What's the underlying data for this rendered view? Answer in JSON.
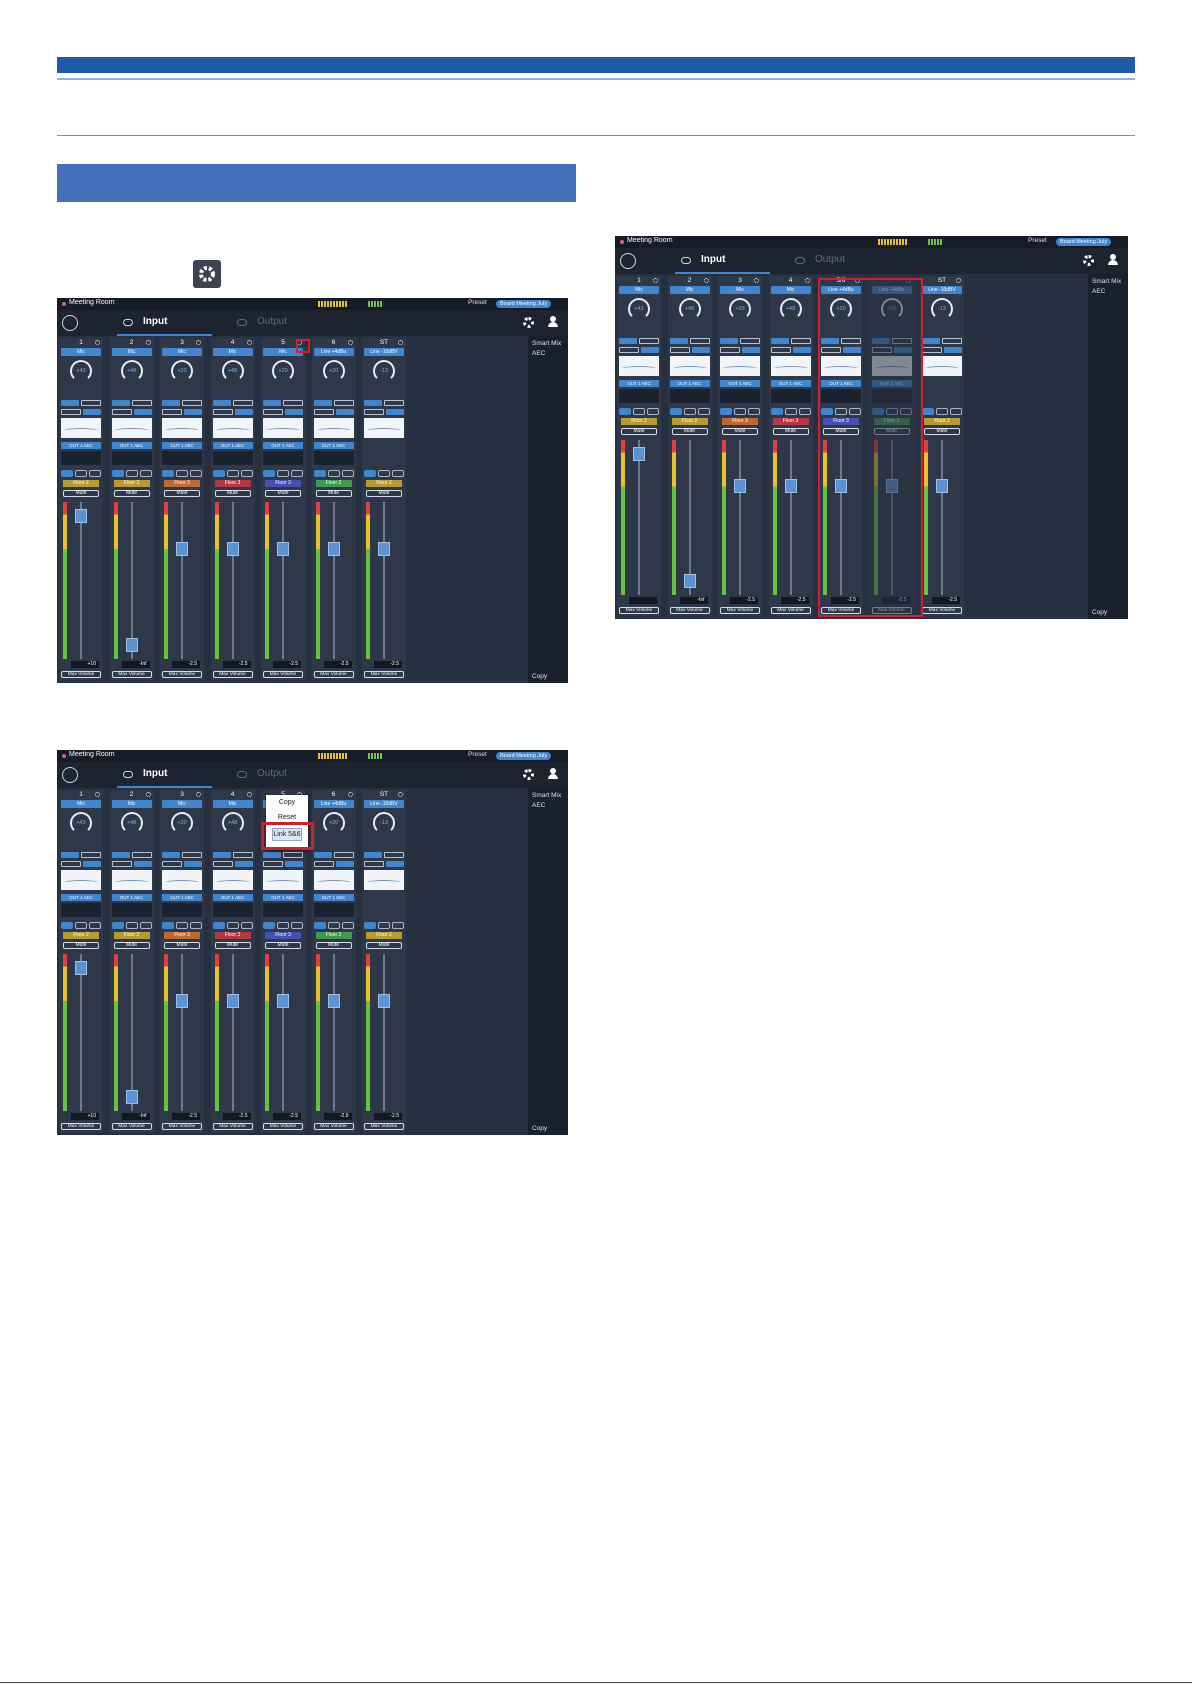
{
  "mixers": [
    {
      "room_name": "Meeting Room",
      "preset_label": "Preset",
      "preset_value": "Board Meeting July",
      "tab_input": "Input",
      "tab_output": "Output",
      "side_items": [
        "Smart Mix",
        "AEC"
      ],
      "side_copy": "Copy",
      "strips": [
        {
          "num": "1",
          "type": "Mic",
          "gain": "+43",
          "aec": "OUT 1 AEC",
          "floor": "Floor 2",
          "floor_color": "#b89a2f",
          "mute": "Mute",
          "value": "+10",
          "maxvol": "Max Volume",
          "fader": 0.05
        },
        {
          "num": "2",
          "type": "Mic",
          "gain": "+48",
          "aec": "OUT 1 AEC",
          "floor": "Floor 2",
          "floor_color": "#b89a2f",
          "mute": "Mute",
          "value": "-Inf",
          "maxvol": "Max Volume",
          "fader": 0.95
        },
        {
          "num": "3",
          "type": "Mic",
          "gain": "+20",
          "aec": "OUT 1 AEC",
          "floor": "Floor 3",
          "floor_color": "#c0682f",
          "mute": "Mute",
          "value": "-2.5",
          "maxvol": "Max Volume",
          "fader": 0.28
        },
        {
          "num": "4",
          "type": "Mic",
          "gain": "+48",
          "aec": "OUT 1 AEC",
          "floor": "Floor 3",
          "floor_color": "#b5373f",
          "mute": "Mute",
          "value": "-2.5",
          "maxvol": "Max Volume",
          "fader": 0.28
        },
        {
          "num": "5",
          "type": "Mic",
          "gain": "+20",
          "aec": "OUT 1 AEC",
          "floor": "Floor 3",
          "floor_color": "#4650b4",
          "mute": "Mute",
          "value": "-2.5",
          "maxvol": "Max Volume",
          "fader": 0.28
        },
        {
          "num": "6",
          "type": "Line +4dBu",
          "gain": "+20",
          "aec": "OUT 1 AEC",
          "floor": "Floor 2",
          "floor_color": "#3f9a4e",
          "mute": "Mute",
          "value": "-2.5",
          "maxvol": "Max Volume",
          "fader": 0.28
        },
        {
          "num": "ST",
          "type": "Line -10dBV",
          "gain": "-13",
          "aec": "",
          "floor": "Floor 2",
          "floor_color": "#b89a2f",
          "mute": "Mute",
          "value": "-2.5",
          "maxvol": "Max Volume",
          "fader": 0.28
        }
      ]
    },
    {
      "room_name": "Meeting Room",
      "preset_label": "Preset",
      "preset_value": "Board Meeting July",
      "tab_input": "Input",
      "tab_output": "Output",
      "side_items": [
        "Smart Mix",
        "AEC"
      ],
      "side_copy": "Copy",
      "popup": {
        "copy": "Copy",
        "reset": "Reset",
        "link": "Link 5&6"
      },
      "strips": [
        {
          "num": "1",
          "type": "Mic",
          "gain": "+43",
          "aec": "OUT 1 AEC",
          "floor": "Floor 2",
          "floor_color": "#b89a2f",
          "mute": "Mute",
          "value": "+10",
          "maxvol": "Max Volume",
          "fader": 0.05
        },
        {
          "num": "2",
          "type": "Mic",
          "gain": "+48",
          "aec": "OUT 1 AEC",
          "floor": "Floor 2",
          "floor_color": "#b89a2f",
          "mute": "Mute",
          "value": "-Inf",
          "maxvol": "Max Volume",
          "fader": 0.95
        },
        {
          "num": "3",
          "type": "Mic",
          "gain": "+20",
          "aec": "OUT 1 AEC",
          "floor": "Floor 3",
          "floor_color": "#c0682f",
          "mute": "Mute",
          "value": "-2.5",
          "maxvol": "Max Volume",
          "fader": 0.28
        },
        {
          "num": "4",
          "type": "Mic",
          "gain": "+48",
          "aec": "OUT 1 AEC",
          "floor": "Floor 3",
          "floor_color": "#b5373f",
          "mute": "Mute",
          "value": "-2.5",
          "maxvol": "Max Volume",
          "fader": 0.28
        },
        {
          "num": "5",
          "type": "Mic",
          "gain": "+20",
          "aec": "OUT 1 AEC",
          "floor": "Floor 3",
          "floor_color": "#4650b4",
          "mute": "Mute",
          "value": "-2.5",
          "maxvol": "Max Volume",
          "fader": 0.28
        },
        {
          "num": "6",
          "type": "Line +4dBu",
          "gain": "+20",
          "aec": "OUT 1 AEC",
          "floor": "Floor 2",
          "floor_color": "#3f9a4e",
          "mute": "Mute",
          "value": "-2.5",
          "maxvol": "Max Volume",
          "fader": 0.28
        },
        {
          "num": "ST",
          "type": "Line -10dBV",
          "gain": "-13",
          "aec": "",
          "floor": "Floor 2",
          "floor_color": "#b89a2f",
          "mute": "Mute",
          "value": "-2.5",
          "maxvol": "Max Volume",
          "fader": 0.28
        }
      ]
    },
    {
      "room_name": "Meeting Room",
      "preset_label": "Preset",
      "preset_value": "Board Meeting July",
      "tab_input": "Input",
      "tab_output": "Output",
      "side_items": [
        "Smart Mix",
        "AEC"
      ],
      "side_copy": "Copy",
      "strips": [
        {
          "num": "1",
          "type": "Mic",
          "gain": "+43",
          "aec": "OUT 1 AEC",
          "floor": "Floor 2",
          "floor_color": "#b89a2f",
          "mute": "Mute",
          "value": "",
          "maxvol": "Max Volume",
          "fader": 0.05
        },
        {
          "num": "2",
          "type": "Mic",
          "gain": "+48",
          "aec": "OUT 1 AEC",
          "floor": "Floor 2",
          "floor_color": "#b89a2f",
          "mute": "Mute",
          "value": "-Inf",
          "maxvol": "Max Volume",
          "fader": 0.95
        },
        {
          "num": "3",
          "type": "Mic",
          "gain": "+33",
          "aec": "OUT 1 AEC",
          "floor": "Floor 3",
          "floor_color": "#c0682f",
          "mute": "Mute",
          "value": "-2.5",
          "maxvol": "Max Volume",
          "fader": 0.28
        },
        {
          "num": "4",
          "type": "Mic",
          "gain": "+48",
          "aec": "OUT 1 AEC",
          "floor": "Floor 3",
          "floor_color": "#b5373f",
          "mute": "Mute",
          "value": "-2.5",
          "maxvol": "Max Volume",
          "fader": 0.28
        },
        {
          "num": "5/6",
          "type": "Line +4dBu",
          "gain": "+20",
          "aec": "OUT 1 AEC",
          "floor": "Floor 3",
          "floor_color": "#4650b4",
          "mute": "Mute",
          "value": "-2.5",
          "maxvol": "Max Volume",
          "fader": 0.28
        },
        {
          "num": "",
          "type": "Line +4dBu",
          "gain": "+20",
          "aec": "OUT 1 AEC",
          "floor": "Floor 2",
          "floor_color": "#3f9a4e",
          "mute": "Mute",
          "value": "-2.5",
          "maxvol": "Max Volume",
          "fader": 0.28,
          "gray": true
        },
        {
          "num": "ST",
          "type": "Line -10dBV",
          "gain": "-13",
          "aec": "",
          "floor": "Floor 2",
          "floor_color": "#b89a2f",
          "mute": "Mute",
          "value": "-2.5",
          "maxvol": "Max Volume",
          "fader": 0.28
        }
      ]
    }
  ]
}
